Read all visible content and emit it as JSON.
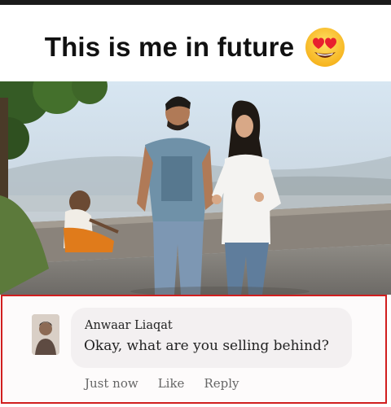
{
  "post": {
    "caption": "This is me in future",
    "emoji": "heart-eyes-emoji",
    "photo": "couple-walking-photo"
  },
  "comment": {
    "author": "Anwaar Liaqat",
    "text": "Okay, what are you selling behind?",
    "time": "Just now",
    "like_label": "Like",
    "reply_label": "Reply",
    "highlight_color": "#d11f1f"
  }
}
